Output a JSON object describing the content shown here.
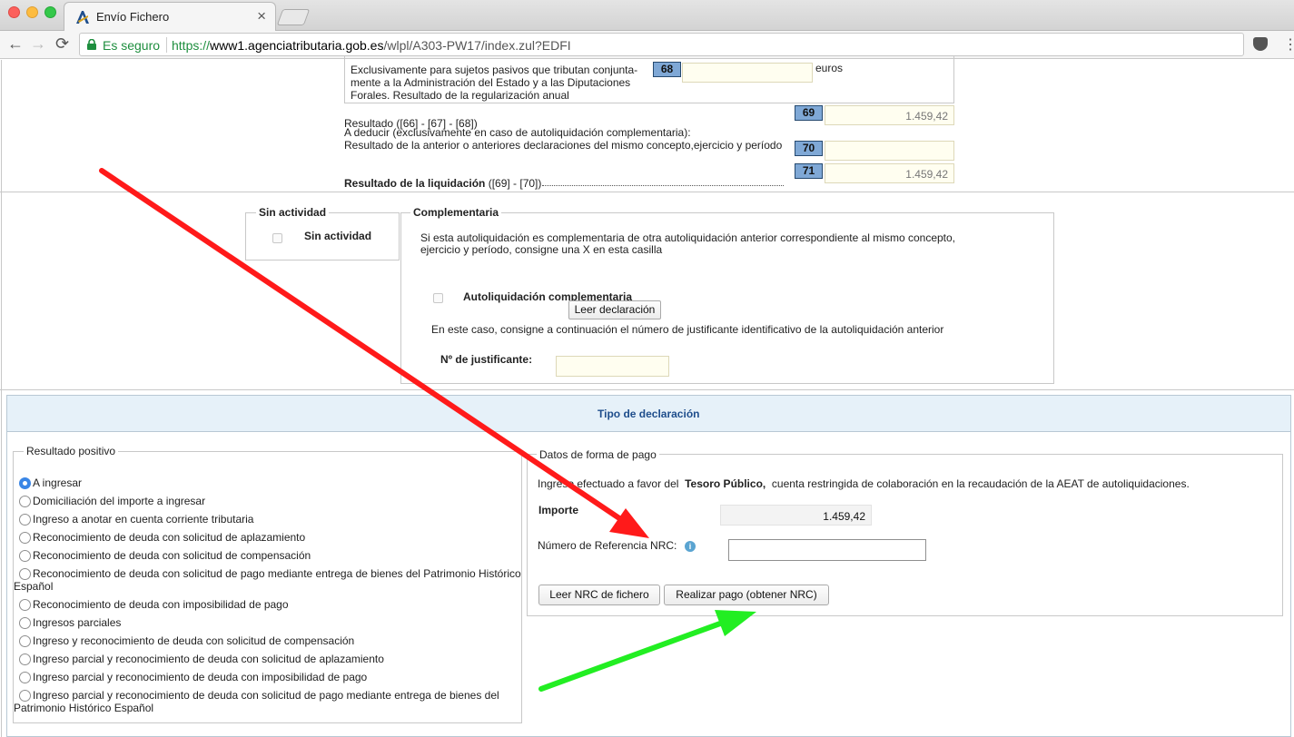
{
  "browser": {
    "tab_title": "Envío Fichero",
    "tab_close": "×",
    "secure_label": "Es seguro",
    "url_scheme": "https://",
    "url_host": "www1.agenciatributaria.gob.es",
    "url_path": "/wlpl/A303-PW17/index.zul?EDFI",
    "back": "←",
    "forward": "→",
    "reload": "⟳",
    "star": "☆",
    "menu": "⋮"
  },
  "liquidacion": {
    "box68_line1": "Exclusivamente para sujetos pasivos que tributan conjunta-",
    "box68_line2": "mente a la Administración del Estado y a las Diputaciones",
    "box68_line3": "Forales. Resultado de la regularización anual",
    "box68_badge": "68",
    "box68_unit": "euros",
    "resultado_label": "Resultado ([66] - [67] - [68])",
    "badge69": "69",
    "value69": "1.459,42",
    "deducir_line1": "A deducir (exclusivamente en caso de autoliquidación complementaria):",
    "deducir_line2": "Resultado de la anterior o anteriores declaraciones del mismo concepto,ejercicio y período",
    "badge70": "70",
    "badge71": "71",
    "value71": "1.459,42",
    "liquidacion_label": "Resultado de la liquidación",
    "liquidacion_formula": "([69] - [70])"
  },
  "sin_actividad": {
    "legend": "Sin actividad",
    "checkbox_label": "Sin actividad"
  },
  "complementaria": {
    "legend": "Complementaria",
    "text_line1": "Si esta autoliquidación es complementaria de otra autoliquidación anterior correspondiente al mismo concepto,",
    "text_line2": "ejercicio y período, consigne una X en esta casilla",
    "checkbox_label": "Autoliquidación complementaria",
    "leer_button": "Leer declaración",
    "en_este_caso": "En este caso, consigne a continuación el número de justificante identificativo de la autoliquidación anterior",
    "justificante_label": "Nº de justificante:"
  },
  "tipo": {
    "header": "Tipo de declaración",
    "resultado_legend": "Resultado positivo",
    "options": [
      "A ingresar",
      "Domiciliación del importe a ingresar",
      "Ingreso a anotar en cuenta corriente tributaria",
      "Reconocimiento de deuda con solicitud de aplazamiento",
      "Reconocimiento de deuda con solicitud de compensación",
      "Reconocimiento de deuda con solicitud de pago mediante entrega de bienes del Patrimonio Histórico Español",
      "Reconocimiento de deuda con imposibilidad de pago",
      "Ingresos parciales",
      "Ingreso y reconocimiento de deuda con solicitud de compensación",
      "Ingreso parcial y reconocimiento de deuda con solicitud de aplazamiento",
      "Ingreso parcial y reconocimiento de deuda con imposibilidad de pago",
      "Ingreso parcial y reconocimiento de deuda con solicitud de pago mediante entrega de bienes del Patrimonio Histórico Español"
    ],
    "selected_index": 0
  },
  "pago": {
    "legend": "Datos de forma de pago",
    "ingreso_prefix": "Ingreso efectuado a favor del",
    "tesoro": "Tesoro Público,",
    "ingreso_suffix": "cuenta restringida de colaboración en la recaudación de la AEAT de autoliquidaciones.",
    "importe_label": "Importe",
    "importe_value": "1.459,42",
    "nrc_label": "Número de Referencia  NRC:",
    "nrc_value": "",
    "info_glyph": "i",
    "leer_nrc_button": "Leer NRC de fichero",
    "realizar_pago_button": "Realizar pago (obtener NRC)"
  },
  "annotations": {
    "red_arrow_color": "#ff1a1a",
    "green_arrow_color": "#22ee22"
  }
}
